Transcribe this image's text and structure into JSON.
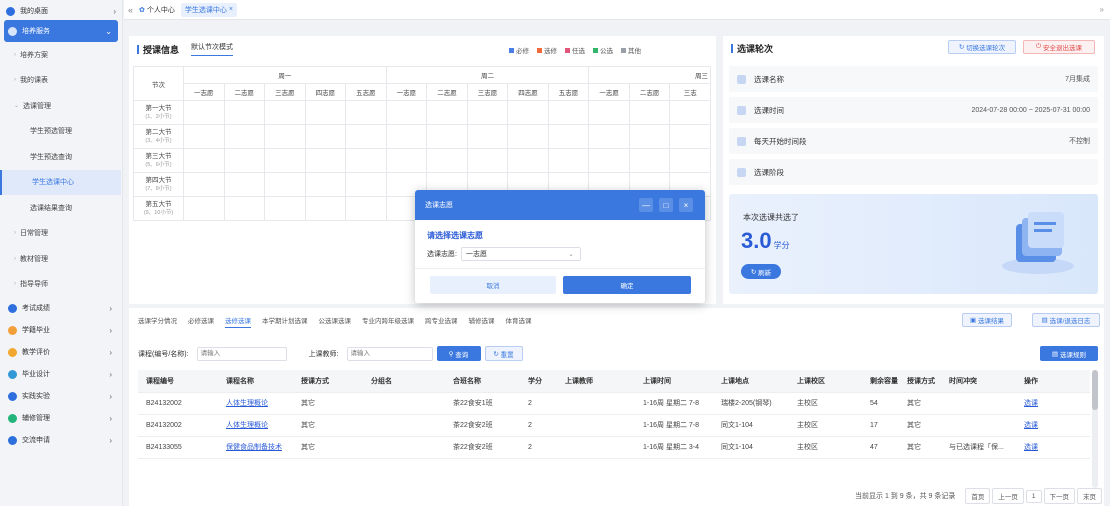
{
  "sidebar": {
    "top": "我的桌面",
    "active": "培养服务",
    "subs": [
      "培养方案",
      "我的课表",
      "选课管理"
    ],
    "subs2": [
      "学生预选管理",
      "学生预选查询",
      "学生选课中心",
      "选课结果查询"
    ],
    "more_subs": [
      "日常管理",
      "教材管理",
      "指导导师"
    ],
    "groups": [
      {
        "label": "考试成绩",
        "color": "#2e6fde"
      },
      {
        "label": "学籍毕业",
        "color": "#f29f3a"
      },
      {
        "label": "教学评价",
        "color": "#f2a72e"
      },
      {
        "label": "毕业设计",
        "color": "#3399d6"
      },
      {
        "label": "实践实验",
        "color": "#2e6fde"
      },
      {
        "label": "辅修管理",
        "color": "#22b47a"
      },
      {
        "label": "交流申请",
        "color": "#2e6fde"
      }
    ]
  },
  "tabbar": {
    "collapse": "«",
    "home": "个人中心",
    "current": "学生选课中心",
    "close": "×",
    "right": "»"
  },
  "timetable": {
    "title": "授课信息",
    "mode": "默认节次模式",
    "legend": [
      {
        "label": "必修",
        "color": "#4a7ee6"
      },
      {
        "label": "选修",
        "color": "#f06a3a"
      },
      {
        "label": "任选",
        "color": "#e0567a"
      },
      {
        "label": "公选",
        "color": "#33b56a"
      },
      {
        "label": "其他",
        "color": "#9a9fa8"
      }
    ],
    "col_header": "节次",
    "days": [
      "周一",
      "周二",
      "周三"
    ],
    "wishes": [
      "一志愿",
      "二志愿",
      "三志愿",
      "四志愿",
      "五志愿",
      "一志愿",
      "二志愿",
      "三志愿",
      "四志愿",
      "五志愿",
      "一志愿",
      "二志愿",
      "三志"
    ],
    "rows": [
      {
        "name": "第一大节",
        "sub": "(1、2小节)"
      },
      {
        "name": "第二大节",
        "sub": "(3、4小节)"
      },
      {
        "name": "第三大节",
        "sub": "(5、6小节)"
      },
      {
        "name": "第四大节",
        "sub": "(7、8小节)"
      },
      {
        "name": "第五大节",
        "sub": "(9、10小节)"
      }
    ]
  },
  "round": {
    "title": "选课轮次",
    "switch_btn": "切换选课轮次",
    "exit_btn": "安全退出选课",
    "items": [
      {
        "label": "选课名称",
        "value": "7月集成"
      },
      {
        "label": "选课时间",
        "value": "2024-07-28 00:00 ~ 2025-07-31 00:00"
      },
      {
        "label": "每天开始时间段",
        "value": "不控制"
      },
      {
        "label": "选课阶段",
        "value": ""
      }
    ],
    "banner_text": "本次选课共选了",
    "credits": "3.0",
    "credits_unit": "学分",
    "refresh": "刷新"
  },
  "modal": {
    "title": "选课志愿",
    "heading": "请选择选课志愿",
    "label": "选课志愿:",
    "value": "一志愿",
    "cancel": "取消",
    "confirm": "确定",
    "min": "—",
    "max": "□",
    "close": "×"
  },
  "tabs": [
    "选课学分情况",
    "必修选课",
    "选修选课",
    "本学期计划选课",
    "公选课选课",
    "专业内跨年级选课",
    "跨专业选课",
    "辅修选课",
    "体育选课"
  ],
  "tabs_active": 2,
  "right_btns": [
    "选课结果",
    "选课/退选日志"
  ],
  "search": {
    "code_label": "课程(编号/名称):",
    "code_ph": "请输入",
    "teacher_label": "上课教师:",
    "teacher_ph": "请输入",
    "query": "查询",
    "reset": "重置",
    "rules": "选课规则"
  },
  "table": {
    "headers": [
      "课程编号",
      "课程名称",
      "授课方式",
      "分组名",
      "合班名称",
      "学分",
      "上课教师",
      "上课时间",
      "上课地点",
      "上课校区",
      "剩余容量",
      "授课方式",
      "时间冲突",
      "操作"
    ],
    "rows": [
      [
        "B24132002",
        "人体生理概论",
        "其它",
        "",
        "茶22食安1班",
        "2",
        "",
        "1-16周 星期二 7-8",
        "瑞楼2-205(钢琴)",
        "主校区",
        "54",
        "其它",
        "",
        "选课"
      ],
      [
        "B24132002",
        "人体生理概论",
        "其它",
        "",
        "茶22食安2班",
        "2",
        "",
        "1-16周 星期二 7-8",
        "同文1-104",
        "主校区",
        "17",
        "其它",
        "",
        "选课"
      ],
      [
        "B24133055",
        "保健食品制备技术",
        "其它",
        "",
        "茶22食安2班",
        "2",
        "",
        "1-16周 星期二 3-4",
        "同文1-104",
        "主校区",
        "47",
        "其它",
        "与已选课程「保...",
        "选课"
      ]
    ]
  },
  "pager": {
    "info": "当前显示 1 到 9 条，共 9 条记录",
    "first": "首页",
    "prev": "上一页",
    "page": "1",
    "next": "下一页",
    "last": "末页"
  }
}
